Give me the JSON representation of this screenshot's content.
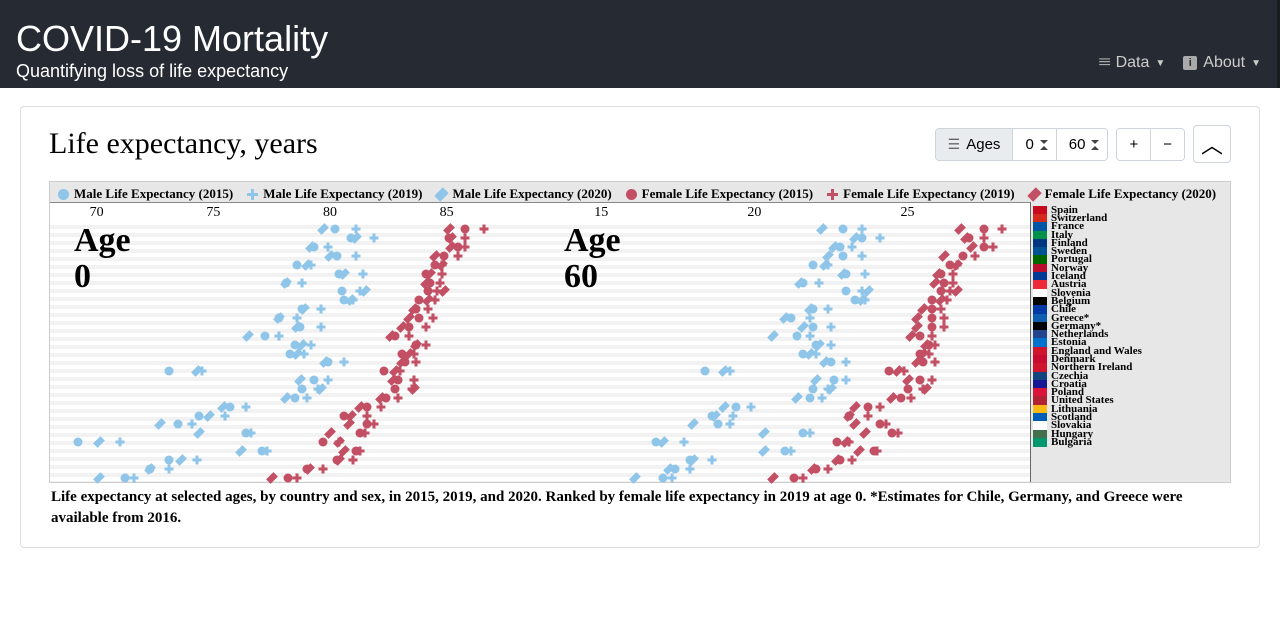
{
  "nav": {
    "title": "COVID-19 Mortality",
    "subtitle": "Quantifying loss of life expectancy",
    "menu_data": "Data",
    "menu_about": "About"
  },
  "panel": {
    "title": "Life expectancy, years",
    "ages_label": "Ages",
    "age_sel_1": "0",
    "age_sel_2": "60",
    "btn_plus": "+",
    "btn_minus": "−"
  },
  "legend": {
    "m2015": "Male Life Expectancy (2015)",
    "m2019": "Male Life Expectancy (2019)",
    "m2020": "Male Life Expectancy (2020)",
    "f2015": "Female Life Expectancy (2015)",
    "f2019": "Female Life Expectancy (2019)",
    "f2020": "Female Life Expectancy (2020)"
  },
  "axis": {
    "p0": {
      "label": "Age 0",
      "ticks": [
        "70",
        "75",
        "80",
        "85"
      ],
      "min": 68,
      "max": 89
    },
    "p60": {
      "label": "Age 60",
      "ticks": [
        "15",
        "20",
        "25"
      ],
      "min": 13,
      "max": 29
    }
  },
  "countries": [
    "Spain",
    "Switzerland",
    "France",
    "Italy",
    "Finland",
    "Sweden",
    "Portugal",
    "Norway",
    "Iceland",
    "Austria",
    "Slovenia",
    "Belgium",
    "Chile",
    "Greece*",
    "Germany*",
    "Netherlands",
    "Estonia",
    "England and Wales",
    "Denmark",
    "Northern Ireland",
    "Czechia",
    "Croatia",
    "Poland",
    "United States",
    "Lithuania",
    "Scotland",
    "Slovakia",
    "Hungary",
    "Bulgaria"
  ],
  "caption": "Life expectancy at selected ages, by country and sex, in 2015, 2019, and 2020. Ranked by female life expectancy in 2019 at age 0. *Estimates for Chile, Germany, and Greece were available from 2016.",
  "chart_data": {
    "type": "scatter",
    "panels": [
      {
        "age": 0,
        "xlim": [
          68,
          89
        ],
        "xticks": [
          70,
          75,
          80,
          85
        ]
      },
      {
        "age": 60,
        "xlim": [
          13,
          29
        ],
        "xticks": [
          15,
          20,
          25
        ]
      }
    ],
    "series_meta": [
      {
        "key": "m2015",
        "sex": "male",
        "year": 2015,
        "marker": "circle"
      },
      {
        "key": "m2019",
        "sex": "male",
        "year": 2019,
        "marker": "plus"
      },
      {
        "key": "m2020",
        "sex": "male",
        "year": 2020,
        "marker": "diamond"
      },
      {
        "key": "f2015",
        "sex": "female",
        "year": 2015,
        "marker": "circle"
      },
      {
        "key": "f2019",
        "sex": "female",
        "year": 2019,
        "marker": "plus"
      },
      {
        "key": "f2020",
        "sex": "female",
        "year": 2020,
        "marker": "diamond"
      }
    ],
    "countries": [
      {
        "name": "Spain",
        "age0": {
          "m2015": 80.2,
          "m2019": 81.1,
          "m2020": 79.7,
          "f2015": 85.8,
          "f2019": 86.6,
          "f2020": 85.1
        },
        "age60": {
          "m2015": 22.9,
          "m2019": 23.5,
          "m2020": 22.2,
          "f2015": 27.5,
          "f2019": 28.1,
          "f2020": 26.7
        }
      },
      {
        "name": "Switzerland",
        "age0": {
          "m2015": 80.9,
          "m2019": 81.9,
          "m2020": 81.1,
          "f2015": 85.1,
          "f2019": 85.8,
          "f2020": 85.2
        },
        "age60": {
          "m2015": 23.5,
          "m2019": 24.1,
          "m2020": 23.3,
          "f2015": 27.0,
          "f2019": 27.5,
          "f2020": 26.9
        }
      },
      {
        "name": "France",
        "age0": {
          "m2015": 79.3,
          "m2019": 79.9,
          "m2020": 79.2,
          "f2015": 85.5,
          "f2019": 85.8,
          "f2020": 85.2
        },
        "age60": {
          "m2015": 22.8,
          "m2019": 23.2,
          "m2020": 22.6,
          "f2015": 27.5,
          "f2019": 27.8,
          "f2020": 27.1
        }
      },
      {
        "name": "Italy",
        "age0": {
          "m2015": 80.3,
          "m2019": 81.1,
          "m2020": 80.0,
          "f2015": 84.9,
          "f2019": 85.5,
          "f2020": 84.5
        },
        "age60": {
          "m2015": 22.9,
          "m2019": 23.5,
          "m2020": 22.4,
          "f2015": 26.8,
          "f2019": 27.2,
          "f2020": 26.2
        }
      },
      {
        "name": "Finland",
        "age0": {
          "m2015": 78.6,
          "m2019": 79.2,
          "m2020": 79.0,
          "f2015": 84.5,
          "f2019": 84.8,
          "f2020": 84.8
        },
        "age60": {
          "m2015": 21.9,
          "m2019": 22.4,
          "m2020": 22.3,
          "f2015": 26.4,
          "f2019": 26.6,
          "f2020": 26.6
        }
      },
      {
        "name": "Sweden",
        "age0": {
          "m2015": 80.4,
          "m2019": 81.4,
          "m2020": 80.6,
          "f2015": 84.1,
          "f2019": 84.8,
          "f2020": 84.3
        },
        "age60": {
          "m2015": 23.0,
          "m2019": 23.6,
          "m2020": 22.9,
          "f2015": 26.1,
          "f2019": 26.5,
          "f2020": 26.0
        }
      },
      {
        "name": "Portugal",
        "age0": {
          "m2015": 78.1,
          "m2019": 78.8,
          "m2020": 78.1,
          "f2015": 84.3,
          "f2019": 84.7,
          "f2020": 84.1
        },
        "age60": {
          "m2015": 21.6,
          "m2019": 22.1,
          "m2020": 21.5,
          "f2015": 26.2,
          "f2019": 26.5,
          "f2020": 25.9
        }
      },
      {
        "name": "Norway",
        "age0": {
          "m2015": 80.5,
          "m2019": 81.3,
          "m2020": 81.5,
          "f2015": 84.2,
          "f2019": 84.6,
          "f2020": 84.9
        },
        "age60": {
          "m2015": 23.0,
          "m2019": 23.5,
          "m2020": 23.7,
          "f2015": 26.1,
          "f2019": 26.4,
          "f2020": 26.6
        }
      },
      {
        "name": "Iceland",
        "age0": {
          "m2015": 80.6,
          "m2019": 81.0,
          "m2020": 80.9,
          "f2015": 83.8,
          "f2019": 84.5,
          "f2020": 84.2
        },
        "age60": {
          "m2015": 23.3,
          "m2019": 23.6,
          "m2020": 23.5,
          "f2015": 25.8,
          "f2019": 26.3,
          "f2020": 26.1
        }
      },
      {
        "name": "Austria",
        "age0": {
          "m2015": 78.8,
          "m2019": 79.6,
          "m2020": 78.9,
          "f2015": 83.7,
          "f2019": 84.2,
          "f2020": 83.6
        },
        "age60": {
          "m2015": 21.9,
          "m2019": 22.4,
          "m2020": 21.8,
          "f2015": 25.8,
          "f2019": 26.1,
          "f2020": 25.5
        }
      },
      {
        "name": "Slovenia",
        "age0": {
          "m2015": 77.8,
          "m2019": 78.6,
          "m2020": 77.8,
          "f2015": 83.8,
          "f2019": 84.4,
          "f2020": 83.4
        },
        "age60": {
          "m2015": 21.2,
          "m2019": 21.8,
          "m2020": 21.0,
          "f2015": 25.8,
          "f2019": 26.2,
          "f2020": 25.3
        }
      },
      {
        "name": "Belgium",
        "age0": {
          "m2015": 78.7,
          "m2019": 79.6,
          "m2020": 78.6,
          "f2015": 83.4,
          "f2019": 84.1,
          "f2020": 83.1
        },
        "age60": {
          "m2015": 21.9,
          "m2019": 22.5,
          "m2020": 21.6,
          "f2015": 25.8,
          "f2019": 26.2,
          "f2020": 25.3
        }
      },
      {
        "name": "Chile",
        "age0": {
          "m2015": 77.2,
          "m2019": 77.8,
          "m2020": 76.5,
          "f2015": 82.8,
          "f2019": 83.4,
          "f2020": 82.6
        },
        "age60": {
          "m2015": 21.4,
          "m2019": 21.8,
          "m2020": 20.6,
          "f2015": 25.4,
          "f2019": 25.8,
          "f2020": 25.1
        }
      },
      {
        "name": "Greece*",
        "age0": {
          "m2015": 78.5,
          "m2019": 79.2,
          "m2020": 78.8,
          "f2015": 83.7,
          "f2019": 84.1,
          "f2020": 83.7
        },
        "age60": {
          "m2015": 22.0,
          "m2019": 22.5,
          "m2020": 22.1,
          "f2015": 25.7,
          "f2019": 25.9,
          "f2020": 25.6
        }
      },
      {
        "name": "Germany*",
        "age0": {
          "m2015": 78.3,
          "m2019": 78.9,
          "m2020": 78.6,
          "f2015": 83.1,
          "f2019": 83.6,
          "f2020": 83.4
        },
        "age60": {
          "m2015": 21.6,
          "m2019": 22.0,
          "m2020": 21.8,
          "f2015": 25.4,
          "f2019": 25.7,
          "f2020": 25.5
        }
      },
      {
        "name": "Netherlands",
        "age0": {
          "m2015": 79.9,
          "m2019": 80.6,
          "m2020": 79.8,
          "f2015": 83.2,
          "f2019": 83.7,
          "f2020": 83.1
        },
        "age60": {
          "m2015": 22.5,
          "m2019": 23.0,
          "m2020": 22.3,
          "f2015": 25.5,
          "f2019": 25.9,
          "f2020": 25.3
        }
      },
      {
        "name": "Estonia",
        "age0": {
          "m2015": 73.1,
          "m2019": 74.5,
          "m2020": 74.3,
          "f2015": 82.3,
          "f2019": 83.0,
          "f2020": 82.8
        },
        "age60": {
          "m2015": 18.4,
          "m2019": 19.2,
          "m2020": 19.0,
          "f2015": 24.4,
          "f2019": 24.9,
          "f2020": 24.7
        }
      },
      {
        "name": "England and Wales",
        "age0": {
          "m2015": 79.3,
          "m2019": 79.9,
          "m2020": 78.7,
          "f2015": 82.9,
          "f2019": 83.6,
          "f2020": 82.7
        },
        "age60": {
          "m2015": 22.6,
          "m2019": 23.0,
          "m2020": 22.0,
          "f2015": 25.4,
          "f2019": 25.8,
          "f2020": 25.0
        }
      },
      {
        "name": "Denmark",
        "age0": {
          "m2015": 78.8,
          "m2019": 79.5,
          "m2020": 79.6,
          "f2015": 82.8,
          "f2019": 83.5,
          "f2020": 83.6
        },
        "age60": {
          "m2015": 21.9,
          "m2019": 22.4,
          "m2020": 22.5,
          "f2015": 25.0,
          "f2019": 25.5,
          "f2020": 25.6
        }
      },
      {
        "name": "Northern Ireland",
        "age0": {
          "m2015": 78.5,
          "m2019": 79.0,
          "m2020": 78.1,
          "f2015": 82.4,
          "f2019": 82.9,
          "f2020": 82.2
        },
        "age60": {
          "m2015": 21.8,
          "m2019": 22.2,
          "m2020": 21.4,
          "f2015": 24.8,
          "f2019": 25.1,
          "f2020": 24.5
        }
      },
      {
        "name": "Czechia",
        "age0": {
          "m2015": 75.7,
          "m2019": 76.4,
          "m2020": 75.4,
          "f2015": 81.6,
          "f2019": 82.2,
          "f2020": 81.3
        },
        "age60": {
          "m2015": 19.4,
          "m2019": 19.9,
          "m2020": 19.0,
          "f2015": 23.7,
          "f2019": 24.1,
          "f2020": 23.3
        }
      },
      {
        "name": "Croatia",
        "age0": {
          "m2015": 74.4,
          "m2019": 75.5,
          "m2020": 74.8,
          "f2015": 80.6,
          "f2019": 81.6,
          "f2020": 80.9
        },
        "age60": {
          "m2015": 18.6,
          "m2019": 19.3,
          "m2020": 18.7,
          "f2015": 23.1,
          "f2019": 23.7,
          "f2020": 23.1
        }
      },
      {
        "name": "Poland",
        "age0": {
          "m2015": 73.5,
          "m2019": 74.1,
          "m2020": 72.7,
          "f2015": 81.6,
          "f2019": 81.9,
          "f2020": 80.8
        },
        "age60": {
          "m2015": 18.8,
          "m2019": 19.2,
          "m2020": 18.0,
          "f2015": 24.1,
          "f2019": 24.3,
          "f2020": 23.3
        }
      },
      {
        "name": "United States",
        "age0": {
          "m2015": 76.4,
          "m2019": 76.6,
          "m2020": 74.4,
          "f2015": 81.3,
          "f2019": 81.5,
          "f2020": 80.0
        },
        "age60": {
          "m2015": 21.6,
          "m2019": 21.8,
          "m2020": 20.3,
          "f2015": 24.5,
          "f2019": 24.7,
          "f2020": 23.6
        }
      },
      {
        "name": "Lithuania",
        "age0": {
          "m2015": 69.2,
          "m2019": 71.0,
          "m2020": 70.1,
          "f2015": 79.7,
          "f2019": 80.4,
          "f2020": 80.4
        },
        "age60": {
          "m2015": 16.8,
          "m2019": 17.7,
          "m2020": 17.0,
          "f2015": 22.7,
          "f2019": 23.1,
          "f2020": 23.0
        }
      },
      {
        "name": "Scotland",
        "age0": {
          "m2015": 77.1,
          "m2019": 77.3,
          "m2020": 76.2,
          "f2015": 81.1,
          "f2019": 81.3,
          "f2020": 80.6
        },
        "age60": {
          "m2015": 21.0,
          "m2019": 21.2,
          "m2020": 20.3,
          "f2015": 23.9,
          "f2019": 24.0,
          "f2020": 23.4
        }
      },
      {
        "name": "Slovakia",
        "age0": {
          "m2015": 73.1,
          "m2019": 74.3,
          "m2020": 73.6,
          "f2015": 80.3,
          "f2019": 81.0,
          "f2020": 80.4
        },
        "age60": {
          "m2015": 17.9,
          "m2019": 18.6,
          "m2020": 18.0,
          "f2015": 22.8,
          "f2019": 23.2,
          "f2020": 22.7
        }
      },
      {
        "name": "Hungary",
        "age0": {
          "m2015": 72.3,
          "m2019": 73.1,
          "m2020": 72.3,
          "f2015": 79.0,
          "f2019": 79.7,
          "f2020": 79.1
        },
        "age60": {
          "m2015": 17.4,
          "m2019": 17.9,
          "m2020": 17.2,
          "f2015": 22.0,
          "f2019": 22.4,
          "f2020": 21.9
        }
      },
      {
        "name": "Bulgaria",
        "age0": {
          "m2015": 71.2,
          "m2019": 71.6,
          "m2020": 70.1,
          "f2015": 78.2,
          "f2019": 78.6,
          "f2020": 77.5
        },
        "age60": {
          "m2015": 17.0,
          "m2019": 17.3,
          "m2020": 16.1,
          "f2015": 21.3,
          "f2019": 21.6,
          "f2020": 20.6
        }
      }
    ]
  }
}
